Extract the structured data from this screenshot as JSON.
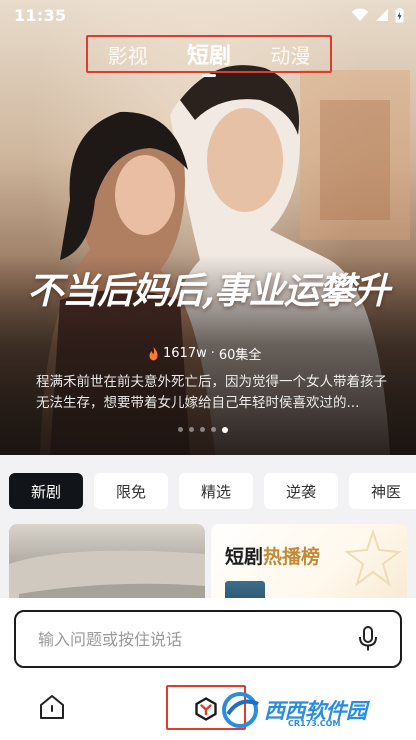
{
  "status_bar": {
    "time": "11:35",
    "icons": [
      "wifi-icon",
      "signal-icon",
      "battery-icon"
    ]
  },
  "top_tabs": [
    {
      "label": "影视",
      "active": false
    },
    {
      "label": "短剧",
      "active": true
    },
    {
      "label": "动漫",
      "active": false
    }
  ],
  "hero": {
    "title": "不当后妈后,事业运攀升",
    "heat": "1617w",
    "separator": "·",
    "episodes": "60集全",
    "description": "程满禾前世在前夫意外死亡后，因为觉得一个女人带着孩子无法生存，想要带着女儿嫁给自己年轻时侯喜欢过的...",
    "carousel_total": 5,
    "carousel_active": 4
  },
  "categories": [
    {
      "label": "新剧",
      "active": true
    },
    {
      "label": "限免",
      "active": false
    },
    {
      "label": "精选",
      "active": false
    },
    {
      "label": "逆袭",
      "active": false
    },
    {
      "label": "神医",
      "active": false
    }
  ],
  "ranking_card": {
    "title_prefix": "短剧",
    "title_highlight": "热播榜"
  },
  "search": {
    "placeholder": "输入问题或按住说话"
  },
  "watermark": {
    "text": "西西软件园",
    "sub": "CR173.COM"
  },
  "colors": {
    "accent_red": "#e23a2e",
    "chip_active_bg": "#111418",
    "hot_gold": "#c48a36",
    "flame": "#ff7a2a"
  }
}
